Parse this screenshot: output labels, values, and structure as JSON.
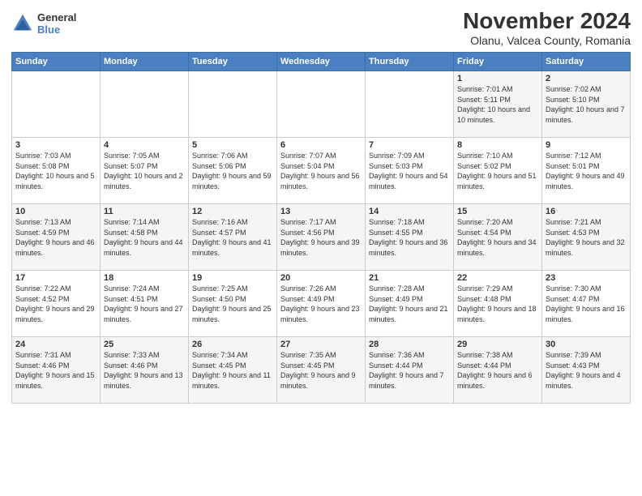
{
  "logo": {
    "general": "General",
    "blue": "Blue"
  },
  "title": "November 2024",
  "location": "Olanu, Valcea County, Romania",
  "weekdays": [
    "Sunday",
    "Monday",
    "Tuesday",
    "Wednesday",
    "Thursday",
    "Friday",
    "Saturday"
  ],
  "weeks": [
    [
      {
        "day": "",
        "sunrise": "",
        "sunset": "",
        "daylight": ""
      },
      {
        "day": "",
        "sunrise": "",
        "sunset": "",
        "daylight": ""
      },
      {
        "day": "",
        "sunrise": "",
        "sunset": "",
        "daylight": ""
      },
      {
        "day": "",
        "sunrise": "",
        "sunset": "",
        "daylight": ""
      },
      {
        "day": "",
        "sunrise": "",
        "sunset": "",
        "daylight": ""
      },
      {
        "day": "1",
        "sunrise": "Sunrise: 7:01 AM",
        "sunset": "Sunset: 5:11 PM",
        "daylight": "Daylight: 10 hours and 10 minutes."
      },
      {
        "day": "2",
        "sunrise": "Sunrise: 7:02 AM",
        "sunset": "Sunset: 5:10 PM",
        "daylight": "Daylight: 10 hours and 7 minutes."
      }
    ],
    [
      {
        "day": "3",
        "sunrise": "Sunrise: 7:03 AM",
        "sunset": "Sunset: 5:08 PM",
        "daylight": "Daylight: 10 hours and 5 minutes."
      },
      {
        "day": "4",
        "sunrise": "Sunrise: 7:05 AM",
        "sunset": "Sunset: 5:07 PM",
        "daylight": "Daylight: 10 hours and 2 minutes."
      },
      {
        "day": "5",
        "sunrise": "Sunrise: 7:06 AM",
        "sunset": "Sunset: 5:06 PM",
        "daylight": "Daylight: 9 hours and 59 minutes."
      },
      {
        "day": "6",
        "sunrise": "Sunrise: 7:07 AM",
        "sunset": "Sunset: 5:04 PM",
        "daylight": "Daylight: 9 hours and 56 minutes."
      },
      {
        "day": "7",
        "sunrise": "Sunrise: 7:09 AM",
        "sunset": "Sunset: 5:03 PM",
        "daylight": "Daylight: 9 hours and 54 minutes."
      },
      {
        "day": "8",
        "sunrise": "Sunrise: 7:10 AM",
        "sunset": "Sunset: 5:02 PM",
        "daylight": "Daylight: 9 hours and 51 minutes."
      },
      {
        "day": "9",
        "sunrise": "Sunrise: 7:12 AM",
        "sunset": "Sunset: 5:01 PM",
        "daylight": "Daylight: 9 hours and 49 minutes."
      }
    ],
    [
      {
        "day": "10",
        "sunrise": "Sunrise: 7:13 AM",
        "sunset": "Sunset: 4:59 PM",
        "daylight": "Daylight: 9 hours and 46 minutes."
      },
      {
        "day": "11",
        "sunrise": "Sunrise: 7:14 AM",
        "sunset": "Sunset: 4:58 PM",
        "daylight": "Daylight: 9 hours and 44 minutes."
      },
      {
        "day": "12",
        "sunrise": "Sunrise: 7:16 AM",
        "sunset": "Sunset: 4:57 PM",
        "daylight": "Daylight: 9 hours and 41 minutes."
      },
      {
        "day": "13",
        "sunrise": "Sunrise: 7:17 AM",
        "sunset": "Sunset: 4:56 PM",
        "daylight": "Daylight: 9 hours and 39 minutes."
      },
      {
        "day": "14",
        "sunrise": "Sunrise: 7:18 AM",
        "sunset": "Sunset: 4:55 PM",
        "daylight": "Daylight: 9 hours and 36 minutes."
      },
      {
        "day": "15",
        "sunrise": "Sunrise: 7:20 AM",
        "sunset": "Sunset: 4:54 PM",
        "daylight": "Daylight: 9 hours and 34 minutes."
      },
      {
        "day": "16",
        "sunrise": "Sunrise: 7:21 AM",
        "sunset": "Sunset: 4:53 PM",
        "daylight": "Daylight: 9 hours and 32 minutes."
      }
    ],
    [
      {
        "day": "17",
        "sunrise": "Sunrise: 7:22 AM",
        "sunset": "Sunset: 4:52 PM",
        "daylight": "Daylight: 9 hours and 29 minutes."
      },
      {
        "day": "18",
        "sunrise": "Sunrise: 7:24 AM",
        "sunset": "Sunset: 4:51 PM",
        "daylight": "Daylight: 9 hours and 27 minutes."
      },
      {
        "day": "19",
        "sunrise": "Sunrise: 7:25 AM",
        "sunset": "Sunset: 4:50 PM",
        "daylight": "Daylight: 9 hours and 25 minutes."
      },
      {
        "day": "20",
        "sunrise": "Sunrise: 7:26 AM",
        "sunset": "Sunset: 4:49 PM",
        "daylight": "Daylight: 9 hours and 23 minutes."
      },
      {
        "day": "21",
        "sunrise": "Sunrise: 7:28 AM",
        "sunset": "Sunset: 4:49 PM",
        "daylight": "Daylight: 9 hours and 21 minutes."
      },
      {
        "day": "22",
        "sunrise": "Sunrise: 7:29 AM",
        "sunset": "Sunset: 4:48 PM",
        "daylight": "Daylight: 9 hours and 18 minutes."
      },
      {
        "day": "23",
        "sunrise": "Sunrise: 7:30 AM",
        "sunset": "Sunset: 4:47 PM",
        "daylight": "Daylight: 9 hours and 16 minutes."
      }
    ],
    [
      {
        "day": "24",
        "sunrise": "Sunrise: 7:31 AM",
        "sunset": "Sunset: 4:46 PM",
        "daylight": "Daylight: 9 hours and 15 minutes."
      },
      {
        "day": "25",
        "sunrise": "Sunrise: 7:33 AM",
        "sunset": "Sunset: 4:46 PM",
        "daylight": "Daylight: 9 hours and 13 minutes."
      },
      {
        "day": "26",
        "sunrise": "Sunrise: 7:34 AM",
        "sunset": "Sunset: 4:45 PM",
        "daylight": "Daylight: 9 hours and 11 minutes."
      },
      {
        "day": "27",
        "sunrise": "Sunrise: 7:35 AM",
        "sunset": "Sunset: 4:45 PM",
        "daylight": "Daylight: 9 hours and 9 minutes."
      },
      {
        "day": "28",
        "sunrise": "Sunrise: 7:36 AM",
        "sunset": "Sunset: 4:44 PM",
        "daylight": "Daylight: 9 hours and 7 minutes."
      },
      {
        "day": "29",
        "sunrise": "Sunrise: 7:38 AM",
        "sunset": "Sunset: 4:44 PM",
        "daylight": "Daylight: 9 hours and 6 minutes."
      },
      {
        "day": "30",
        "sunrise": "Sunrise: 7:39 AM",
        "sunset": "Sunset: 4:43 PM",
        "daylight": "Daylight: 9 hours and 4 minutes."
      }
    ]
  ]
}
